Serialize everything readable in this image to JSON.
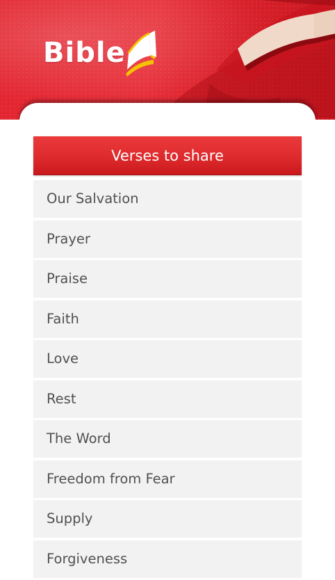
{
  "header": {
    "logo_text": "Bible",
    "logo_icon": "open-book-icon"
  },
  "section": {
    "title": "Verses to share"
  },
  "list": {
    "items": [
      {
        "label": "Our Salvation"
      },
      {
        "label": "Prayer"
      },
      {
        "label": "Praise"
      },
      {
        "label": "Faith"
      },
      {
        "label": "Love"
      },
      {
        "label": "Rest"
      },
      {
        "label": "The Word"
      },
      {
        "label": "Freedom from Fear"
      },
      {
        "label": "Supply"
      },
      {
        "label": "Forgiveness"
      }
    ]
  },
  "colors": {
    "brand_red": "#e2242f",
    "header_bar_red": "#de2a2d",
    "list_item_bg": "#f2f2f2",
    "list_text": "#505050",
    "logo_accent_yellow": "#f5c400"
  }
}
